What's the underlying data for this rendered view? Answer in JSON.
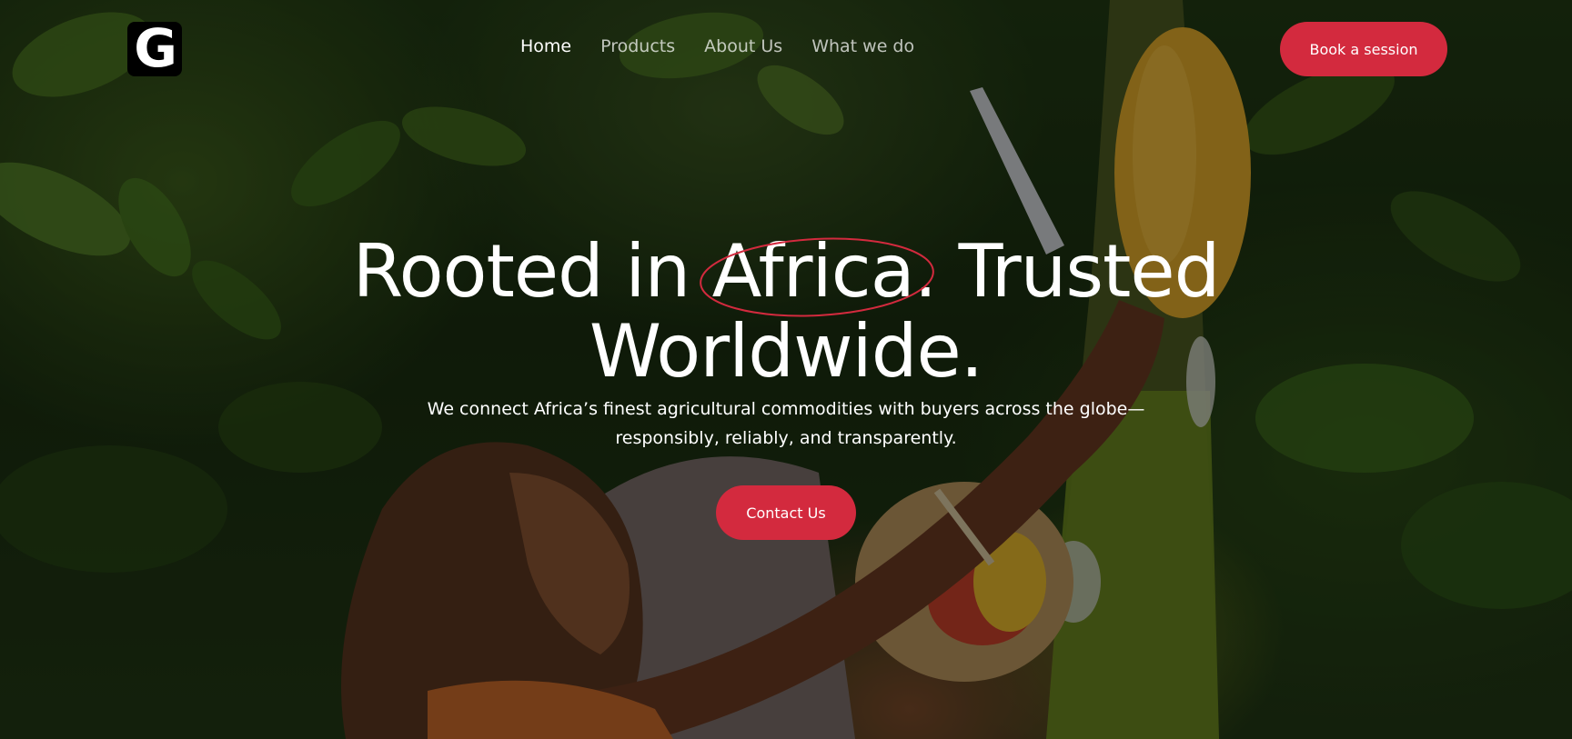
{
  "brand": {
    "logo_letter": "G",
    "logo_icon": "brand-g-logo"
  },
  "nav": {
    "items": [
      {
        "label": "Home",
        "active": true
      },
      {
        "label": "Products",
        "active": false
      },
      {
        "label": "About Us",
        "active": false
      },
      {
        "label": "What we do",
        "active": false
      }
    ]
  },
  "header": {
    "cta_label": "Book a session"
  },
  "hero": {
    "headline_part1": "Rooted in ",
    "headline_highlight": "Africa.",
    "headline_part2": " Trusted",
    "headline_line2": "Worldwide.",
    "subtext": "We connect Africa’s finest agricultural commodities with buyers across the globe—responsibly, reliably, and transparently.",
    "cta_label": "Contact Us",
    "background_image": "cacao-harvest-photo"
  },
  "colors": {
    "accent": "#d32a3e",
    "text": "#ffffff",
    "logo_bg": "#000000"
  }
}
